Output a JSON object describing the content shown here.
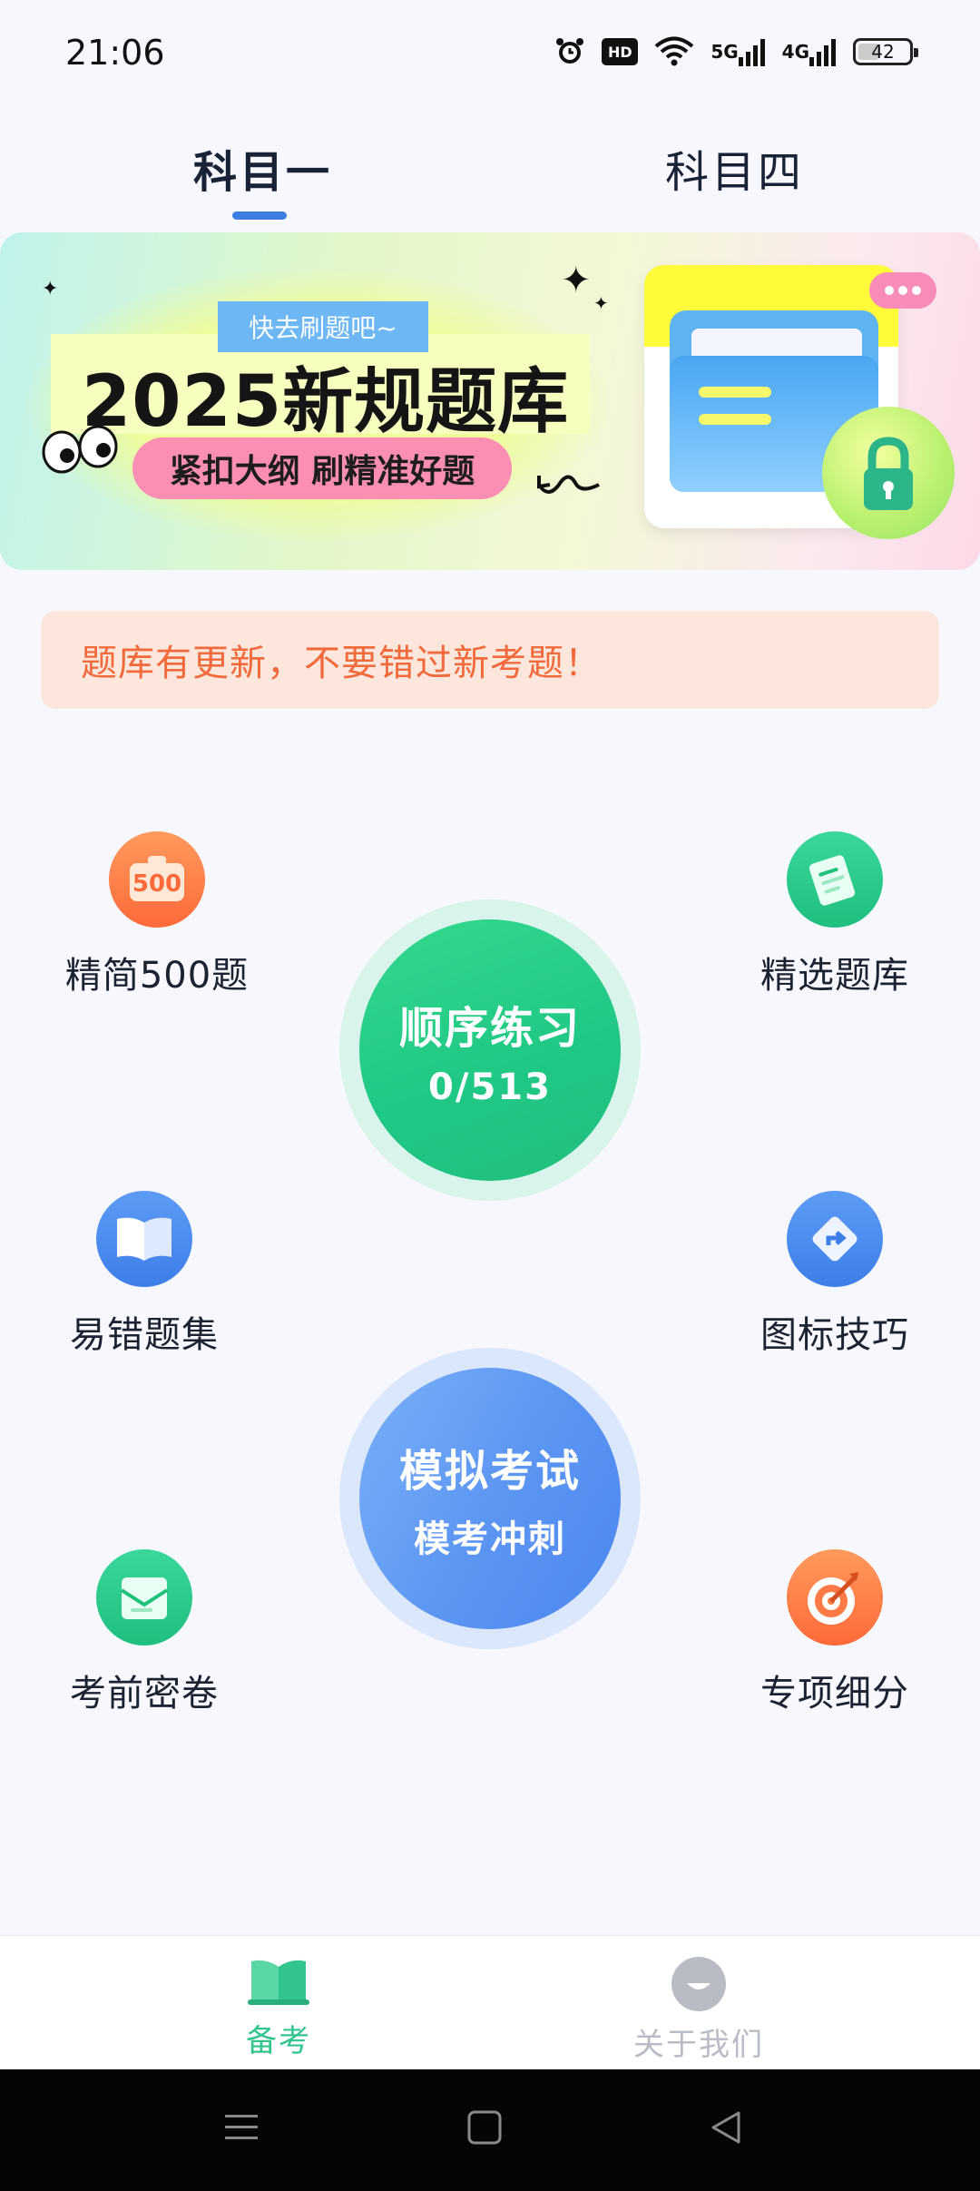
{
  "status_bar": {
    "time": "21:06",
    "hd_label": "HD",
    "net1_label": "5G",
    "net2_label": "4G",
    "battery": "42"
  },
  "tabs": [
    {
      "label": "科目一",
      "active": true
    },
    {
      "label": "科目四",
      "active": false
    }
  ],
  "banner": {
    "tag": "快去刷题吧~",
    "title": "2025新规题库",
    "subtitle": "紧扣大纲 刷精准好题"
  },
  "notice": {
    "text": "题库有更新，不要错过新考题！"
  },
  "features": {
    "left": [
      {
        "label": "精简500题",
        "icon": "500-icon",
        "icon_text": "500"
      },
      {
        "label": "易错题集",
        "icon": "book-icon"
      },
      {
        "label": "考前密卷",
        "icon": "envelope-icon"
      }
    ],
    "right": [
      {
        "label": "精选题库",
        "icon": "document-icon"
      },
      {
        "label": "图标技巧",
        "icon": "road-sign-icon"
      },
      {
        "label": "专项细分",
        "icon": "target-icon"
      }
    ]
  },
  "practice": {
    "title": "顺序练习",
    "progress": "0/513",
    "progress_done": 0,
    "progress_total": 513
  },
  "exam": {
    "title": "模拟考试",
    "subtitle": "模考冲刺"
  },
  "bottom_nav": [
    {
      "label": "备考",
      "icon": "book-icon",
      "active": true
    },
    {
      "label": "关于我们",
      "icon": "smile-icon",
      "active": false
    }
  ],
  "colors": {
    "accent": "#3b7de0",
    "green": "#25c98a",
    "notice_bg": "#fde6dc",
    "notice_text": "#f06a3c",
    "nav_active": "#31c48d",
    "nav_inactive": "#b9bcc4"
  }
}
